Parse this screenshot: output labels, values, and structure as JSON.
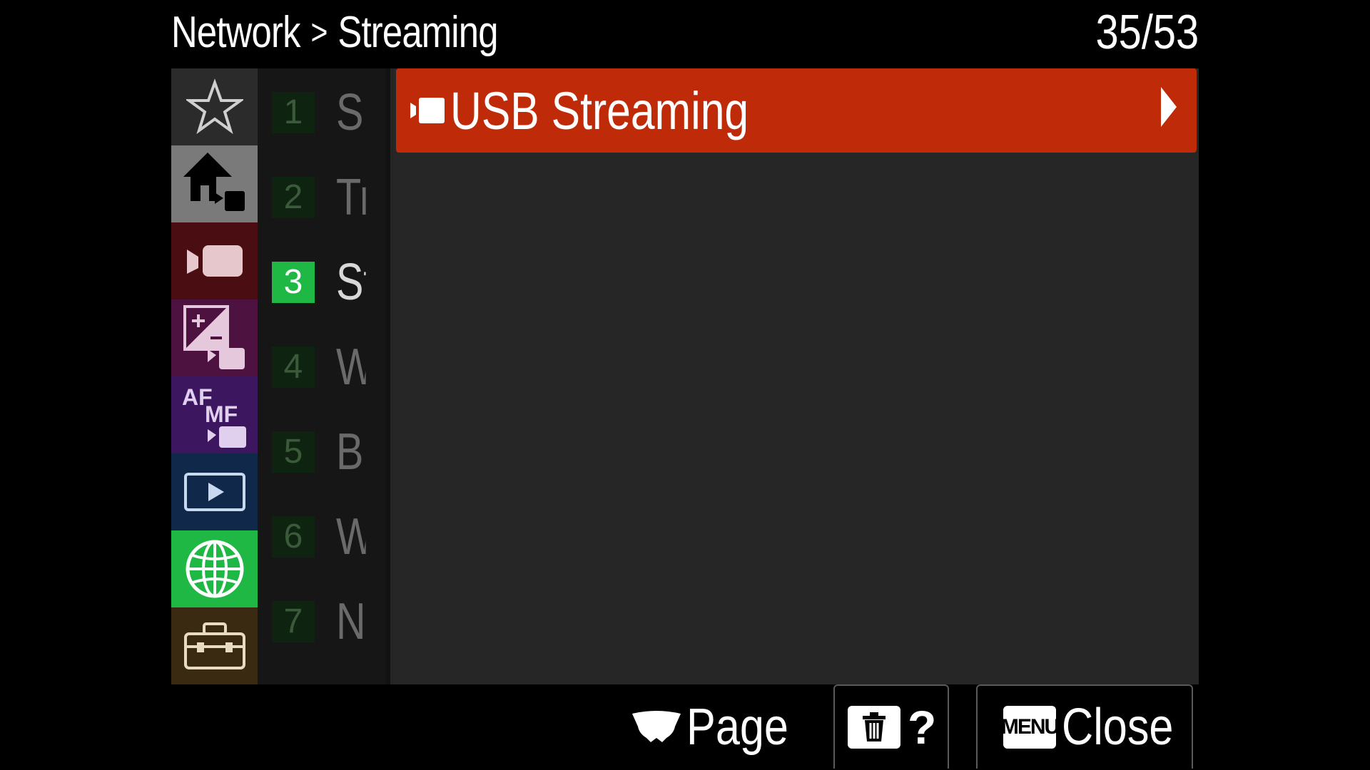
{
  "header": {
    "breadcrumb_parent": "Network",
    "breadcrumb_separator": ">",
    "breadcrumb_current": "Streaming",
    "page_indicator": "35/53"
  },
  "categories": [
    {
      "name": "my-menu",
      "icon": "star-icon",
      "color": "#2b2b2b"
    },
    {
      "name": "main",
      "icon": "home-movie-icon",
      "color": "#7a7a7a"
    },
    {
      "name": "shooting",
      "icon": "movie-camera-icon",
      "color": "#4a0e12"
    },
    {
      "name": "exposure-color",
      "icon": "exposure-comp-icon",
      "color": "#4d1240"
    },
    {
      "name": "focus",
      "icon": "af-mf-icon",
      "color": "#3d1660"
    },
    {
      "name": "playback",
      "icon": "playback-icon",
      "color": "#10284a"
    },
    {
      "name": "network",
      "icon": "globe-icon",
      "color": "#1fb845",
      "selected": true
    },
    {
      "name": "setup",
      "icon": "toolbox-icon",
      "color": "#3a2a12"
    }
  ],
  "sub_pages": [
    {
      "number": "1",
      "label": "Sr"
    },
    {
      "number": "2",
      "label": "Tr"
    },
    {
      "number": "3",
      "label": "St",
      "active": true
    },
    {
      "number": "4",
      "label": "W"
    },
    {
      "number": "5",
      "label": "Bl"
    },
    {
      "number": "6",
      "label": "W"
    },
    {
      "number": "7",
      "label": "Ne"
    }
  ],
  "menu_items": [
    {
      "label": "USB Streaming",
      "selected": true,
      "icon": "movie-mode-icon"
    }
  ],
  "footer": {
    "page_label": "Page",
    "help_label": "?",
    "menu_key_label": "MENU",
    "close_label": "Close"
  },
  "colors": {
    "selected_item": "#bf2a08",
    "active_tab": "#1fb845",
    "content_bg": "#262626"
  }
}
